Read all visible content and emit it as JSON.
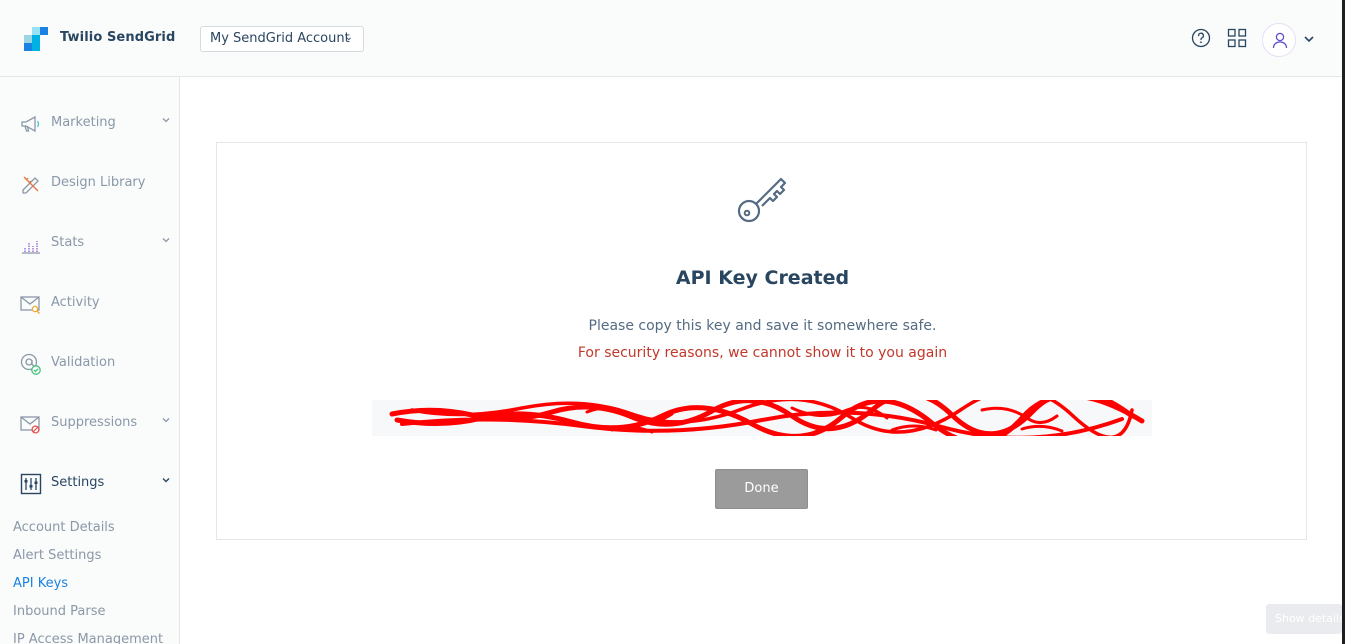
{
  "header": {
    "brand": "Twilio SendGrid",
    "account_select": "My SendGrid Account",
    "icons": [
      "help-icon",
      "apps-grid-icon",
      "user-icon",
      "chevron-down-icon"
    ]
  },
  "sidebar": {
    "items": [
      {
        "label": "Marketing",
        "icon": "megaphone-icon",
        "has_chevron": true
      },
      {
        "label": "Design Library",
        "icon": "pencil-ruler-icon",
        "has_chevron": false
      },
      {
        "label": "Stats",
        "icon": "bar-chart-icon",
        "has_chevron": true
      },
      {
        "label": "Activity",
        "icon": "envelope-search-icon",
        "has_chevron": false
      },
      {
        "label": "Validation",
        "icon": "at-check-icon",
        "has_chevron": false
      },
      {
        "label": "Suppressions",
        "icon": "envelope-block-icon",
        "has_chevron": true
      },
      {
        "label": "Settings",
        "icon": "sliders-icon",
        "has_chevron": true
      }
    ],
    "settings_sub": [
      "Account Details",
      "Alert Settings",
      "API Keys",
      "Inbound Parse",
      "IP Access Management"
    ],
    "current_sub": "API Keys"
  },
  "card": {
    "icon": "key-icon",
    "title": "API Key Created",
    "message": "Please copy this key and save it somewhere safe.",
    "warning": "For security reasons, we cannot show it to you again",
    "done_label": "Done",
    "colors": {
      "warning": "#c0392b",
      "redaction": "#ff0000",
      "done_button": "#9b9b9b"
    }
  },
  "toast": {
    "label": "Show details"
  }
}
